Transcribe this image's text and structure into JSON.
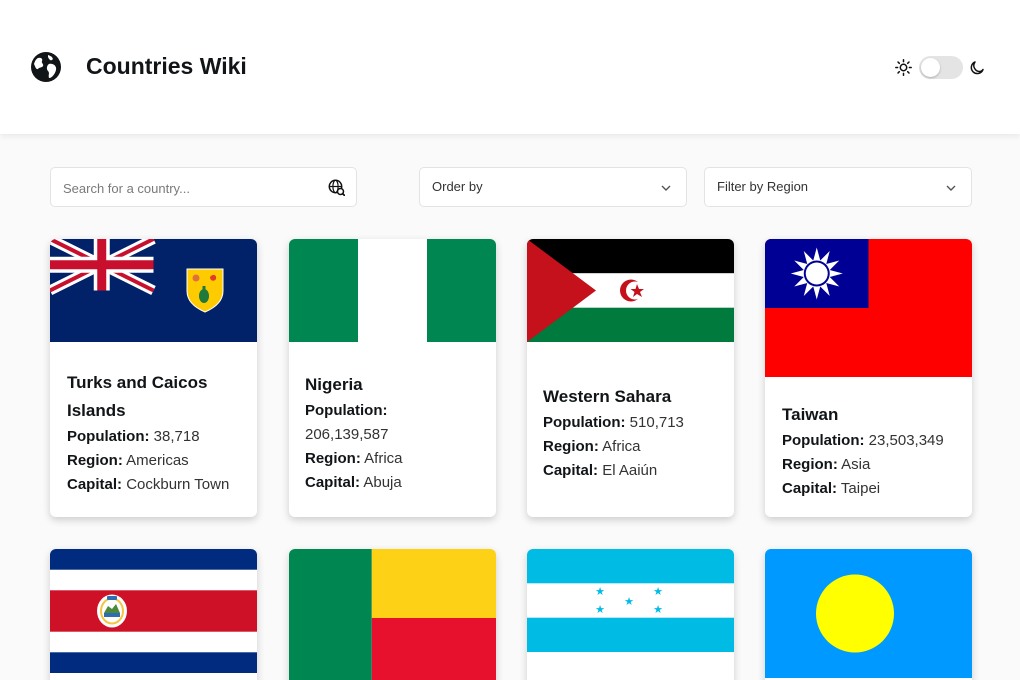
{
  "header": {
    "title": "Countries Wiki",
    "logo_icon": "globe-icon",
    "theme_toggle": {
      "state": "light",
      "sun_icon": "sun-icon",
      "moon_icon": "moon-icon"
    }
  },
  "controls": {
    "search_placeholder": "Search for a country...",
    "search_icon": "globe-search-icon",
    "order_label": "Order by",
    "region_label": "Filter by Region"
  },
  "labels": {
    "population": "Population:",
    "region": "Region:",
    "capital": "Capital:"
  },
  "countries": [
    {
      "name": "Turks and Caicos Islands",
      "population": "38,718",
      "region": "Americas",
      "capital": "Cockburn Town",
      "flag": "turks-and-caicos-flag"
    },
    {
      "name": "Nigeria",
      "population": "206,139,587",
      "region": "Africa",
      "capital": "Abuja",
      "flag": "nigeria-flag"
    },
    {
      "name": "Western Sahara",
      "population": "510,713",
      "region": "Africa",
      "capital": "El Aaiún",
      "flag": "western-sahara-flag"
    },
    {
      "name": "Taiwan",
      "population": "23,503,349",
      "region": "Asia",
      "capital": "Taipei",
      "flag": "taiwan-flag"
    },
    {
      "flag": "costa-rica-flag"
    },
    {
      "flag": "benin-flag"
    },
    {
      "flag": "honduras-flag"
    },
    {
      "flag": "palau-flag"
    }
  ],
  "colors": {
    "background": "#fafafa",
    "card": "#ffffff",
    "text": "#111517"
  }
}
